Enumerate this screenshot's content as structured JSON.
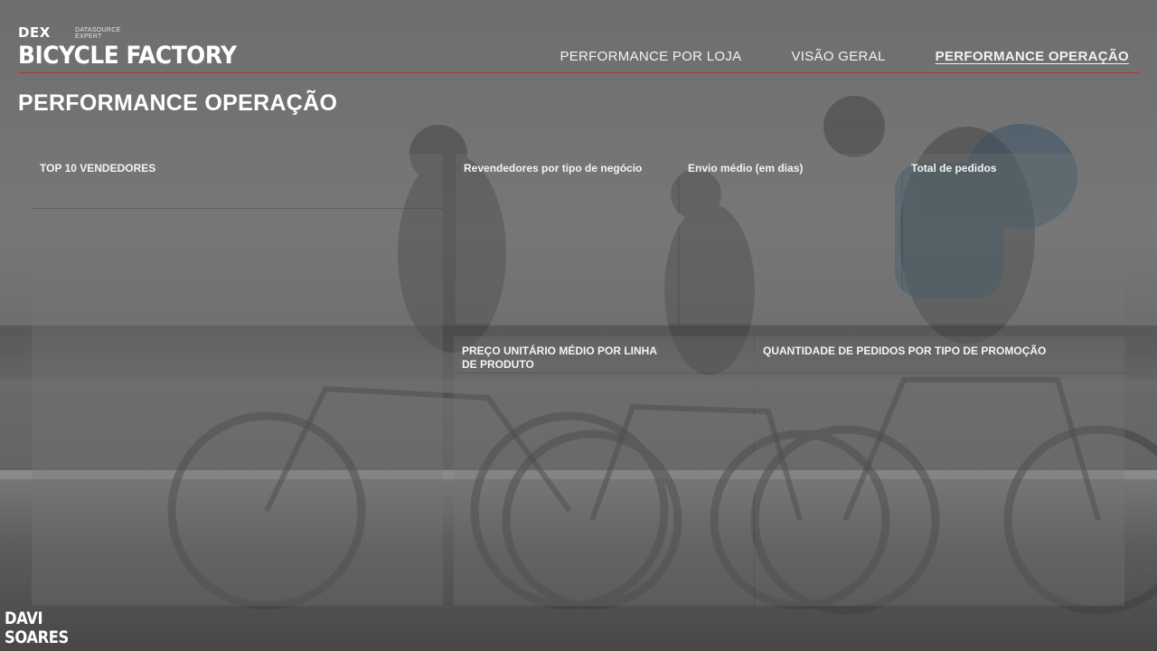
{
  "header": {
    "logo_mark": "DEX",
    "logo_sub_1": "DATASOURCE",
    "logo_sub_2": "EXPERT",
    "brand": "BICYCLE FACTORY"
  },
  "nav": {
    "tabs": [
      {
        "label": "PERFORMANCE POR LOJA",
        "active": false
      },
      {
        "label": "VISÃO GERAL",
        "active": false
      },
      {
        "label": "PERFORMANCE OPERAÇÃO",
        "active": true
      }
    ]
  },
  "page_title": "PERFORMANCE OPERAÇÃO",
  "panels": {
    "top_vendedores": "TOP 10 VENDEDORES",
    "revendedores": "Revendedores por tipo de negócio",
    "envio_medio": "Envio médio (em dias)",
    "total_pedidos": "Total de pedidos",
    "preco_unitario": "PREÇO UNITÁRIO MÉDIO POR LINHA DE PRODUTO",
    "quantidade_pedidos": "QUANTIDADE DE PEDIDOS POR TIPO DE PROMOÇÃO"
  },
  "footer": {
    "line1": "DAVI",
    "line2": "SOARES"
  },
  "colors": {
    "accent_rule": "#b03535",
    "text": "#ffffff"
  }
}
